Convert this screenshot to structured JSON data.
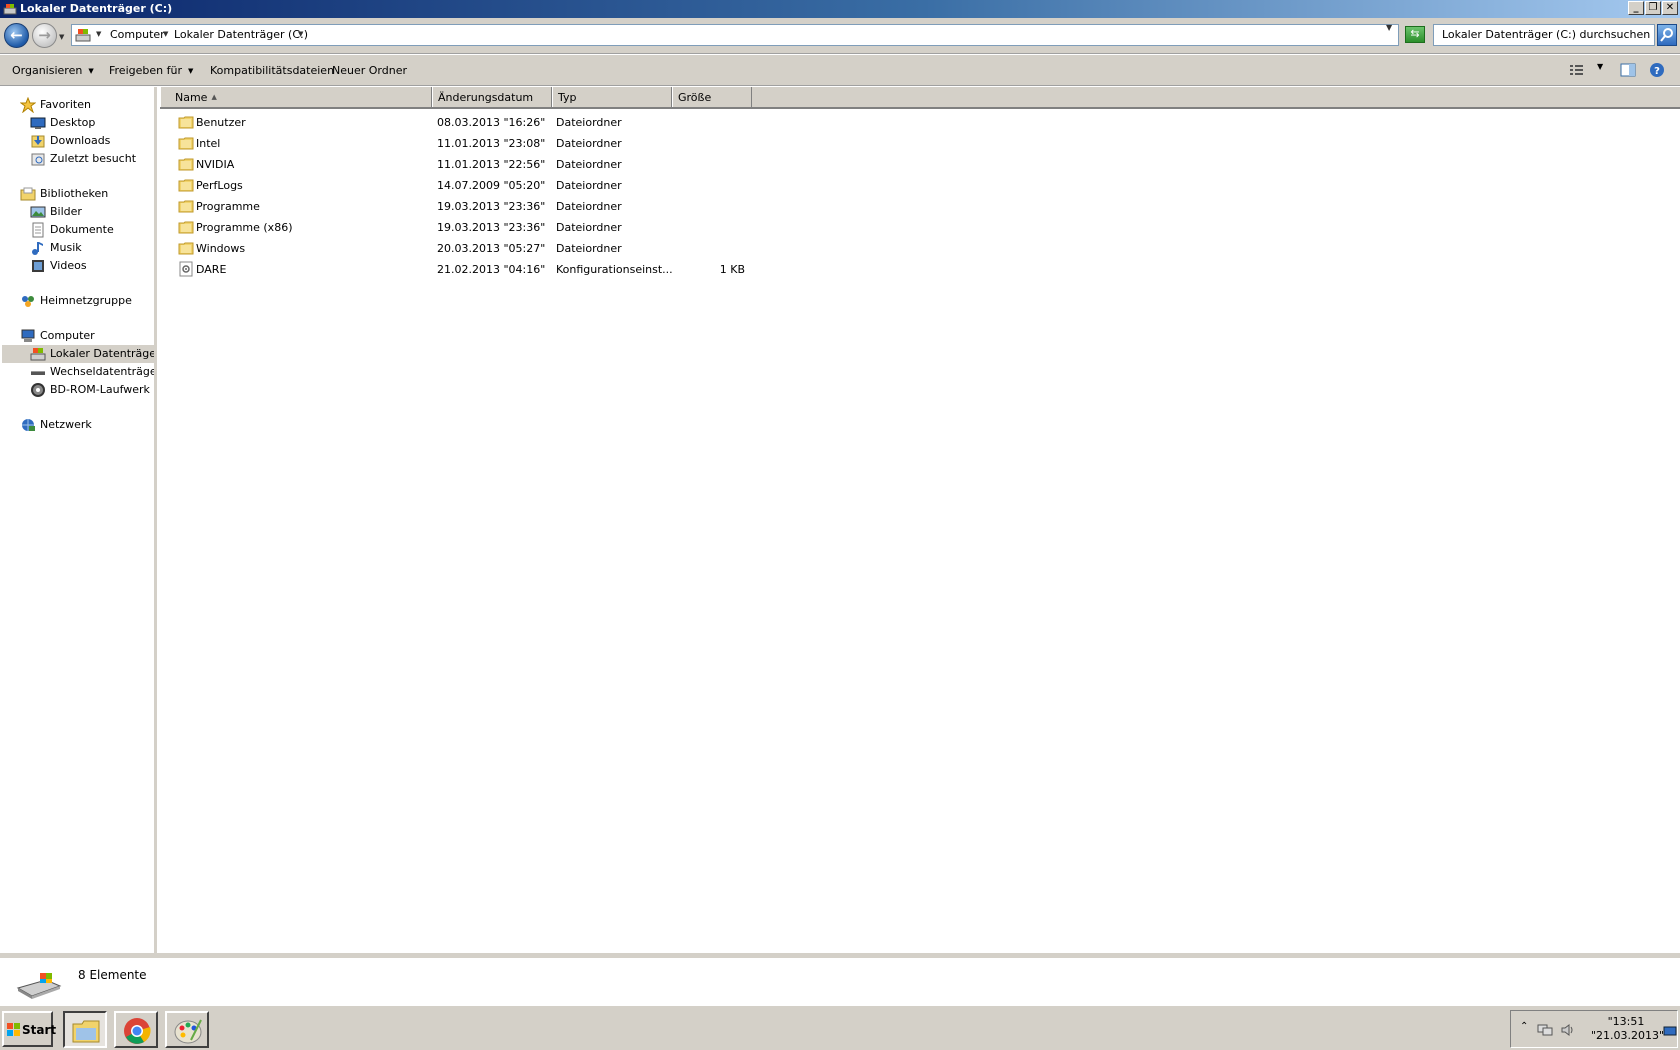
{
  "window": {
    "title": "Lokaler Datenträger (C:)",
    "minimize_label": "_",
    "maximize_label": "❐",
    "close_label": "✕"
  },
  "address": {
    "crumbs": [
      "Computer",
      "Lokaler Datenträger (C:)"
    ],
    "search_placeholder": "Lokaler Datenträger (C:) durchsuchen"
  },
  "commands": {
    "organize": "Organisieren",
    "share": "Freigeben für",
    "compat": "Kompatibilitätsdateien",
    "new_folder": "Neuer Ordner"
  },
  "nav": {
    "favorites": "Favoriten",
    "desktop": "Desktop",
    "downloads": "Downloads",
    "recent": "Zuletzt besucht",
    "libraries": "Bibliotheken",
    "pictures": "Bilder",
    "documents": "Dokumente",
    "music": "Musik",
    "videos": "Videos",
    "homegroup": "Heimnetzgruppe",
    "computer": "Computer",
    "local_disk": "Lokaler Datenträger (C",
    "removable": "Wechseldatenträger (I",
    "bdrom": "BD-ROM-Laufwerk (E:)",
    "network": "Netzwerk"
  },
  "columns": {
    "name": "Name",
    "date": "Änderungsdatum",
    "type": "Typ",
    "size": "Größe"
  },
  "files": [
    {
      "name": "Benutzer",
      "date": "08.03.2013 \"16:26\"",
      "type": "Dateiordner",
      "size": "",
      "kind": "folder"
    },
    {
      "name": "Intel",
      "date": "11.01.2013 \"23:08\"",
      "type": "Dateiordner",
      "size": "",
      "kind": "folder"
    },
    {
      "name": "NVIDIA",
      "date": "11.01.2013 \"22:56\"",
      "type": "Dateiordner",
      "size": "",
      "kind": "folder"
    },
    {
      "name": "PerfLogs",
      "date": "14.07.2009 \"05:20\"",
      "type": "Dateiordner",
      "size": "",
      "kind": "folder"
    },
    {
      "name": "Programme",
      "date": "19.03.2013 \"23:36\"",
      "type": "Dateiordner",
      "size": "",
      "kind": "folder"
    },
    {
      "name": "Programme (x86)",
      "date": "19.03.2013 \"23:36\"",
      "type": "Dateiordner",
      "size": "",
      "kind": "folder"
    },
    {
      "name": "Windows",
      "date": "20.03.2013 \"05:27\"",
      "type": "Dateiordner",
      "size": "",
      "kind": "folder"
    },
    {
      "name": "DARE",
      "date": "21.02.2013 \"04:16\"",
      "type": "Konfigurationseinst...",
      "size": "1 KB",
      "kind": "config-file"
    }
  ],
  "status": {
    "item_count": "8 Elemente"
  },
  "taskbar": {
    "start_label": "Start",
    "clock_time": "\"13:51",
    "clock_date": "\"21.03.2013\"",
    "tray_expand": "⌃"
  }
}
